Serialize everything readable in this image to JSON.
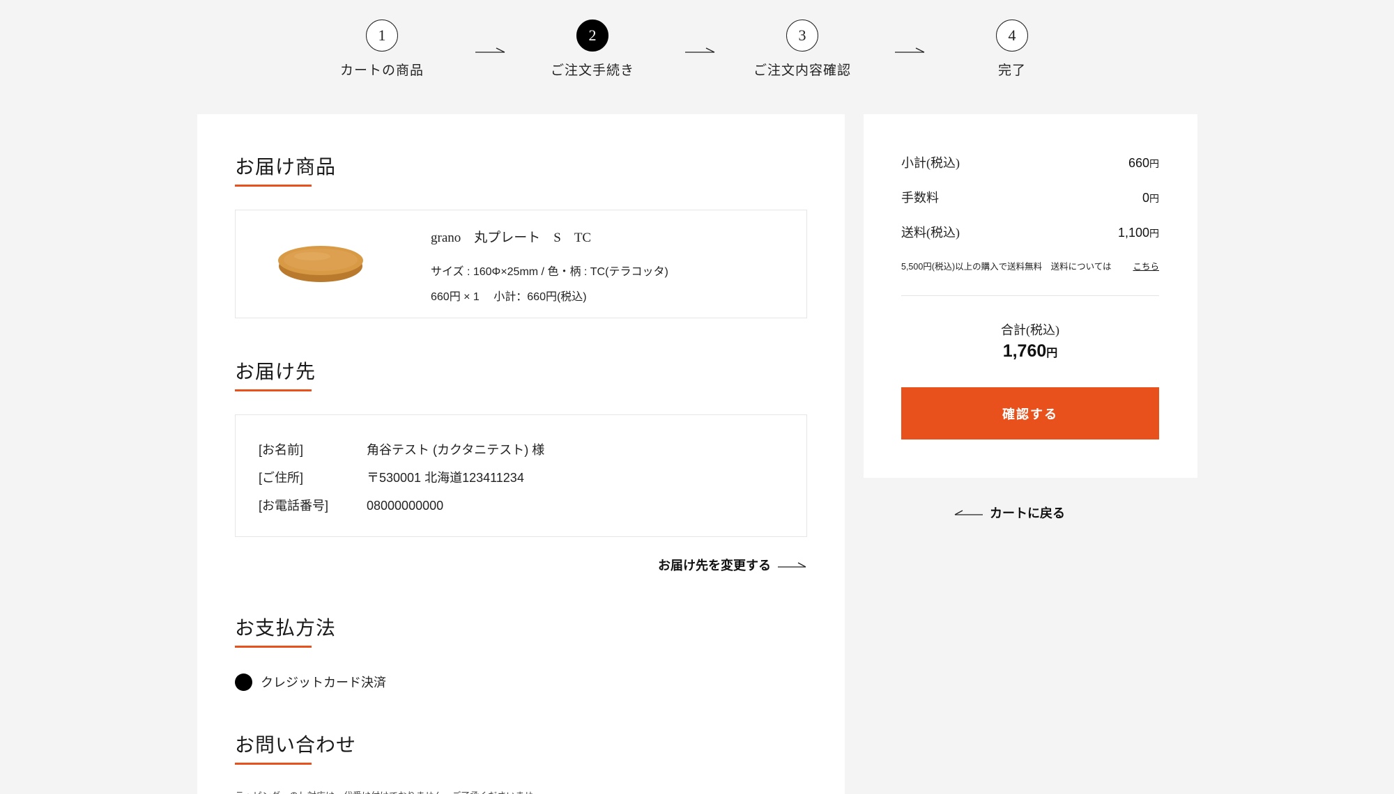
{
  "steps": [
    {
      "number": "1",
      "label": "カートの商品"
    },
    {
      "number": "2",
      "label": "ご注文手続き"
    },
    {
      "number": "3",
      "label": "ご注文内容確認"
    },
    {
      "number": "4",
      "label": "完了"
    }
  ],
  "delivery_items": {
    "title": "お届け商品",
    "product": {
      "name": "grano　丸プレート　S　TC",
      "spec": "サイズ : 160Φ×25mm / 色・柄 : TC(テラコッタ)",
      "price_line": "660円 × 1　 小計：660円(税込)"
    }
  },
  "destination": {
    "title": "お届け先",
    "name_label": "[お名前]",
    "name_value": "角谷テスト (カクタニテスト) 様",
    "address_label": "[ご住所]",
    "address_value": "〒530001 北海道123411234",
    "phone_label": "[お電話番号]",
    "phone_value": "08000000000",
    "change_link": "お届け先を変更する"
  },
  "payment": {
    "title": "お支払方法",
    "option_label": "クレジットカード決済"
  },
  "inquiry": {
    "title": "お問い合わせ",
    "note": "ラッピング・のし対応は、代番は付けておりません。ご了承くださいませ"
  },
  "summary": {
    "subtotal_label": "小計(税込)",
    "subtotal_value": "660",
    "fee_label": "手数料",
    "fee_value": "0",
    "shipping_label": "送料(税込)",
    "shipping_value": "1,100",
    "yen": "円",
    "shipping_note": "5,500円(税込)以上の購入で送料無料　送料については",
    "shipping_link": "こちら",
    "total_label": "合計(税込)",
    "total_value": "1,760",
    "confirm_label": "確認する"
  },
  "back_link": "カートに戻る",
  "colors": {
    "accent": "#e8501c",
    "background": "#f4f4f4",
    "panel": "#ffffff"
  }
}
